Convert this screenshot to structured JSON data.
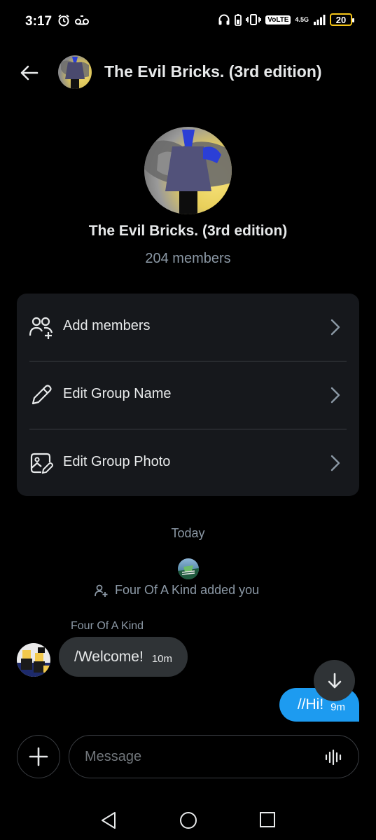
{
  "status_bar": {
    "time": "3:17",
    "network_label": "VoLTE",
    "network_type": "4.5G",
    "battery": "20",
    "icons": [
      "alarm-icon",
      "voicemail-icon",
      "headphones-icon",
      "battery-saver-icon",
      "vibrate-icon",
      "signal-icon"
    ]
  },
  "header": {
    "title": "The Evil Bricks. (3rd edition)",
    "back_icon": "arrow-left-icon"
  },
  "group": {
    "name": "The Evil Bricks. (3rd edition)",
    "members": "204 members"
  },
  "actions": [
    {
      "label": "Add members",
      "icon": "add-users-icon"
    },
    {
      "label": "Edit Group Name",
      "icon": "pencil-icon"
    },
    {
      "label": "Edit Group Photo",
      "icon": "image-edit-icon"
    }
  ],
  "chat": {
    "day_separator": "Today",
    "system_message": "Four Of A Kind added you",
    "messages": [
      {
        "sender": "Four Of A Kind",
        "text": "/Welcome!",
        "time": "10m",
        "direction": "incoming"
      },
      {
        "text": "//Hi!",
        "time": "9m",
        "direction": "outgoing"
      }
    ]
  },
  "composer": {
    "placeholder": "Message"
  },
  "colors": {
    "accent": "#1d9bf0",
    "background": "#000000",
    "card": "#16181c",
    "bubble_incoming": "#2f3336",
    "muted_text": "#8b98a5"
  }
}
